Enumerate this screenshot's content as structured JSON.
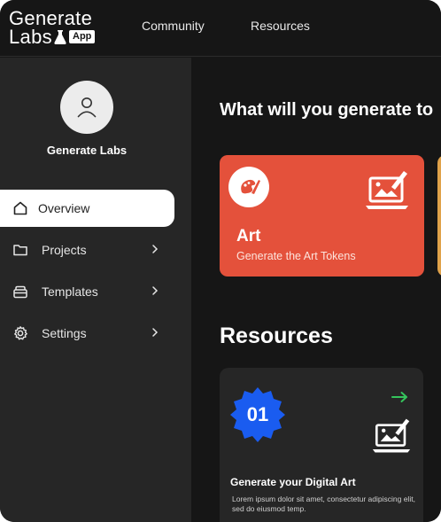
{
  "brand": {
    "line1": "Generate",
    "line2": "Labs",
    "badge": "App"
  },
  "nav": {
    "community": "Community",
    "resources": "Resources"
  },
  "profile": {
    "name": "Generate Labs"
  },
  "sidebar": {
    "items": [
      {
        "label": "Overview",
        "icon": "home-icon",
        "active": true
      },
      {
        "label": "Projects",
        "icon": "folder-icon",
        "active": false
      },
      {
        "label": "Templates",
        "icon": "templates-icon",
        "active": false
      },
      {
        "label": "Settings",
        "icon": "gear-icon",
        "active": false
      }
    ]
  },
  "main": {
    "heading": "What will you generate to",
    "art_card": {
      "title": "Art",
      "subtitle": "Generate the Art Tokens",
      "color": "#e4513b"
    },
    "resources_heading": "Resources",
    "resource_card": {
      "number": "01",
      "title": "Generate your Digital Art",
      "description": "Lorem ipsum dolor sit amet, consectetur adipiscing elit, sed do eiusmod temp.",
      "badge_color": "#1a5cf0",
      "arrow_color": "#35c45c"
    }
  }
}
